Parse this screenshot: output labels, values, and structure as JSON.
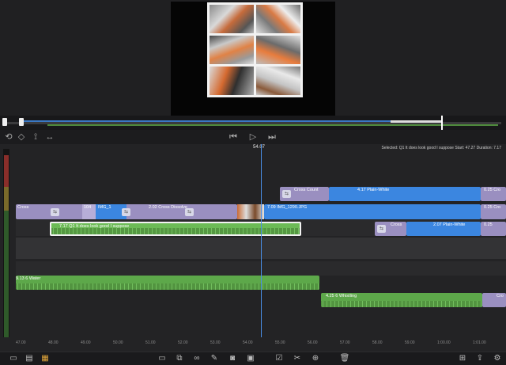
{
  "transport": {
    "left_icons": [
      "undo-icon",
      "marker-icon",
      "split-audio-icon",
      "fit-icon"
    ],
    "center_icons": [
      "skip-back-icon",
      "play-icon",
      "skip-forward-icon"
    ]
  },
  "timeline": {
    "playhead_time": "54.07",
    "info": "Selected: Q1 It does look good I suppose Start: 47.27 Duration: 7.17",
    "video_track": {
      "cross_count_label": "Cross Count",
      "plain_white_1": "4.17  Plain-White",
      "img_clip": "7.09  IMG_1290.JPG",
      "left_labels": [
        "Cross",
        "Sub",
        "IMG",
        "104",
        "IMG_1",
        "Cross",
        "2.02 Cross Dissolve"
      ],
      "right_label_1": "0.25  Cro",
      "right_label_2": "0.25  Cro"
    },
    "audio_sel": {
      "label": "7.17  Q1 It does look good I suppose"
    },
    "right_clips": {
      "cross_label": "Cross",
      "plain_white_2": "2.07  Plain-White",
      "right_label_3": "0.25"
    },
    "water": {
      "label": "9.13  6 Water"
    },
    "whistling": {
      "label": "4.25  6 Whistling",
      "right_label": "Cro"
    },
    "ruler_ticks": [
      "47.00",
      "48.00",
      "49.00",
      "50.00",
      "51.00",
      "52.00",
      "53.00",
      "54.00",
      "55.00",
      "56.00",
      "57.00",
      "58.00",
      "59.00",
      "1:00.00",
      "1:01.00"
    ]
  },
  "toolbar": {
    "icons": [
      "clips-icon",
      "transitions-icon",
      "effects-icon",
      "aspect-icon",
      "copy-icon",
      "link-icon",
      "pen-icon",
      "camera-icon",
      "checkbox-icon",
      "scissors-icon",
      "add-icon",
      "trash-icon",
      "export-icon",
      "settings-icon"
    ]
  }
}
